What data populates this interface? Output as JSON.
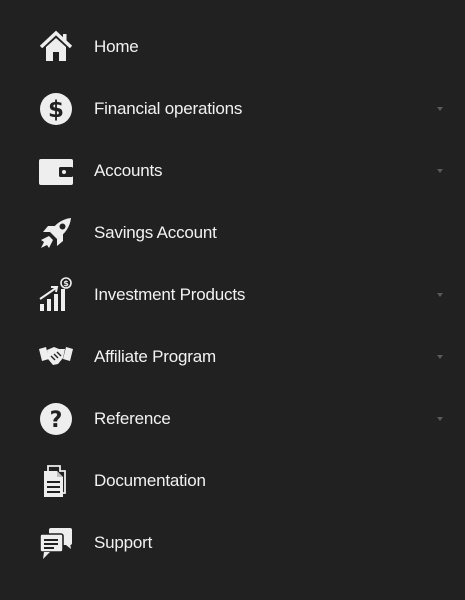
{
  "sidebar": {
    "items": [
      {
        "label": "Home",
        "icon": "home-icon",
        "has_submenu": false
      },
      {
        "label": "Financial operations",
        "icon": "dollar-circle-icon",
        "has_submenu": true
      },
      {
        "label": "Accounts",
        "icon": "wallet-icon",
        "has_submenu": true
      },
      {
        "label": "Savings Account",
        "icon": "rocket-icon",
        "has_submenu": false
      },
      {
        "label": "Investment Products",
        "icon": "growth-chart-icon",
        "has_submenu": true
      },
      {
        "label": "Affiliate Program",
        "icon": "handshake-icon",
        "has_submenu": true
      },
      {
        "label": "Reference",
        "icon": "question-circle-icon",
        "has_submenu": true
      },
      {
        "label": "Documentation",
        "icon": "document-icon",
        "has_submenu": false
      },
      {
        "label": "Support",
        "icon": "chat-bubbles-icon",
        "has_submenu": false
      }
    ]
  },
  "colors": {
    "background": "#212121",
    "text": "#f2f2f2",
    "icon": "#eeeeee",
    "caret": "#5a5a5a"
  }
}
